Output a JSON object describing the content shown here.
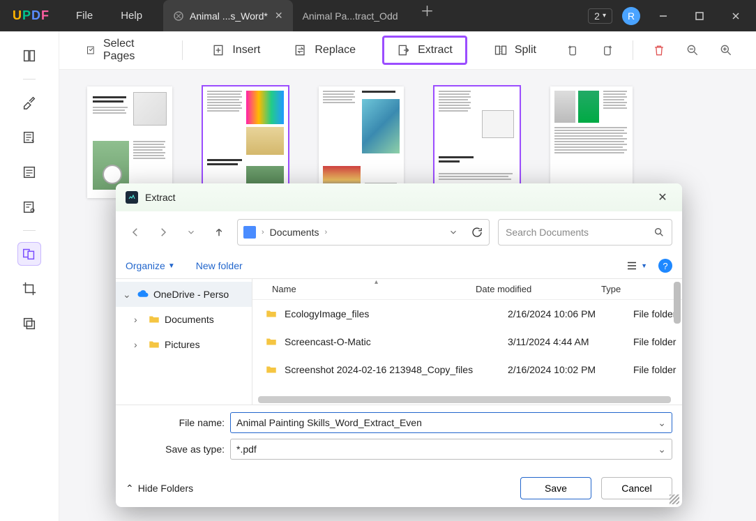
{
  "titlebar": {
    "logo": {
      "u": "U",
      "p": "P",
      "d": "D",
      "f": "F"
    },
    "menu_file": "File",
    "menu_help": "Help",
    "tabs": [
      {
        "label": "Animal ...s_Word*",
        "active": true
      },
      {
        "label": "Animal Pa...tract_Odd",
        "active": false
      }
    ],
    "workspace": "2",
    "avatar": "R"
  },
  "toolbar": {
    "select_pages": "Select Pages",
    "insert": "Insert",
    "replace": "Replace",
    "extract": "Extract",
    "split": "Split"
  },
  "dialog": {
    "title": "Extract",
    "breadcrumb": {
      "location": "Documents"
    },
    "search_placeholder": "Search Documents",
    "organize": "Organize",
    "new_folder": "New folder",
    "tree": {
      "root": "OneDrive - Perso",
      "children": [
        "Documents",
        "Pictures"
      ]
    },
    "columns": {
      "name": "Name",
      "date": "Date modified",
      "type": "Type"
    },
    "rows": [
      {
        "name": "EcologyImage_files",
        "date": "2/16/2024 10:06 PM",
        "type": "File folder"
      },
      {
        "name": "Screencast-O-Matic",
        "date": "3/11/2024 4:44 AM",
        "type": "File folder"
      },
      {
        "name": "Screenshot 2024-02-16 213948_Copy_files",
        "date": "2/16/2024 10:02 PM",
        "type": "File folder"
      }
    ],
    "filename_label": "File name:",
    "filename_value": "Animal Painting Skills_Word_Extract_Even",
    "saveas_label": "Save as type:",
    "saveas_value": "*.pdf",
    "hide_folders": "Hide Folders",
    "save": "Save",
    "cancel": "Cancel"
  }
}
